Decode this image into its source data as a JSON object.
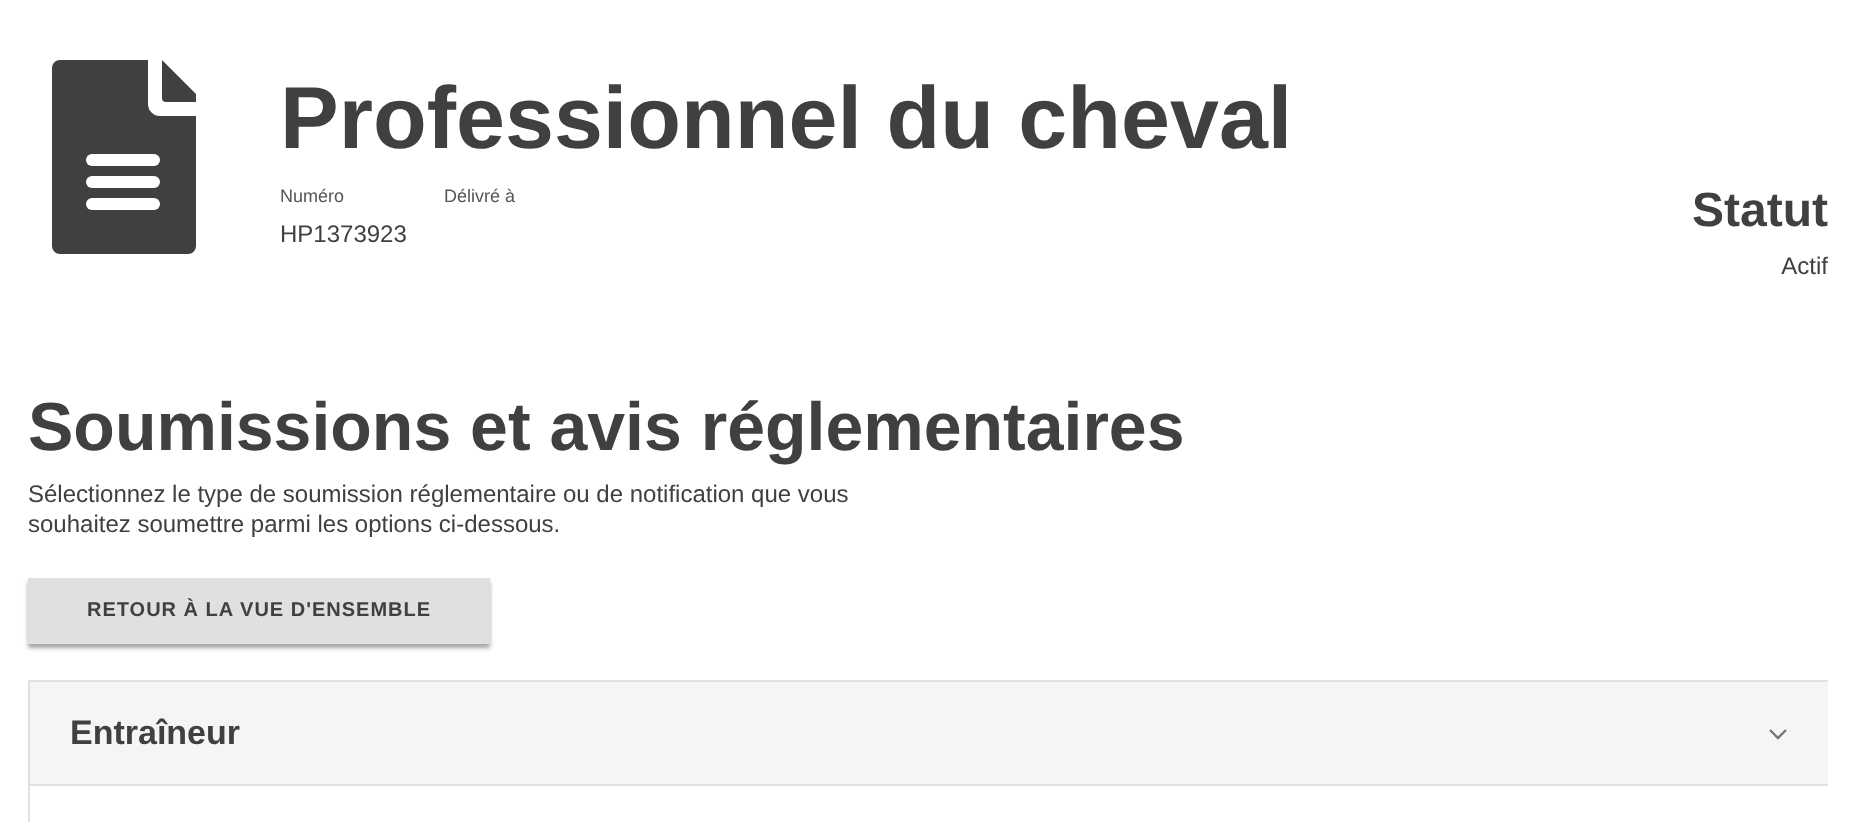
{
  "header": {
    "title": "Professionnel du cheval",
    "fields": [
      {
        "label": "Numéro",
        "value": "HP1373923"
      },
      {
        "label": "Délivré à"
      }
    ],
    "status": {
      "label": "Statut",
      "value": "Actif"
    }
  },
  "section": {
    "title": "Soumissions et avis réglementaires",
    "description": "Sélectionnez le type de soumission réglementaire ou de notification que vous souhaitez soumettre parmi les options ci-dessous.",
    "back_button": "RETOUR À LA VUE D'ENSEMBLE"
  },
  "accordion": [
    {
      "title": "Entraîneur",
      "expanded": false
    }
  ]
}
